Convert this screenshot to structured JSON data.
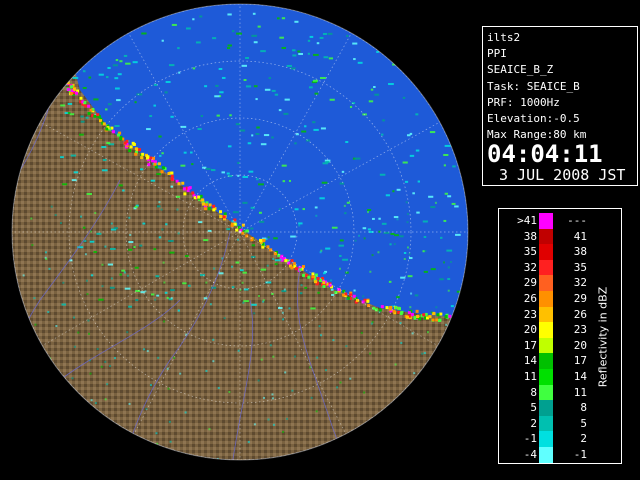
{
  "info": {
    "station": "ilts2",
    "scan_type": "PPI",
    "product": "SEAICE_B_Z",
    "task": "Task: SEAICE_B",
    "prf": "PRF: 1000Hz",
    "elevation": "Elevation:-0.5",
    "max_range": "Max Range:80 km",
    "time": "04:04:11",
    "date": "3 JUL 2008 JST"
  },
  "legend": {
    "title": "Reflectivity in dBZ",
    "rows": [
      {
        "low": ">41",
        "high": "---",
        "color": "#ff00ff"
      },
      {
        "low": "38",
        "high": "41",
        "color": "#c00000"
      },
      {
        "low": "35",
        "high": "38",
        "color": "#e00000"
      },
      {
        "low": "32",
        "high": "35",
        "color": "#ff2020"
      },
      {
        "low": "29",
        "high": "32",
        "color": "#ff6020"
      },
      {
        "low": "26",
        "high": "29",
        "color": "#ff9000"
      },
      {
        "low": "23",
        "high": "26",
        "color": "#ffc000"
      },
      {
        "low": "20",
        "high": "23",
        "color": "#ffff00"
      },
      {
        "low": "17",
        "high": "20",
        "color": "#c0ff00"
      },
      {
        "low": "14",
        "high": "17",
        "color": "#00c000"
      },
      {
        "low": "11",
        "high": "14",
        "color": "#00e000"
      },
      {
        "low": "8",
        "high": "11",
        "color": "#40ff40"
      },
      {
        "low": "5",
        "high": "8",
        "color": "#00a090"
      },
      {
        "low": "2",
        "high": "5",
        "color": "#00c0b0"
      },
      {
        "low": "-1",
        "high": "2",
        "color": "#00e0e0"
      },
      {
        "low": "-4",
        "high": "-1",
        "color": "#60ffff"
      }
    ]
  },
  "radar": {
    "sea_color": "#1e5ad8",
    "land_color": "#7a6240",
    "background_color": "#000000"
  }
}
